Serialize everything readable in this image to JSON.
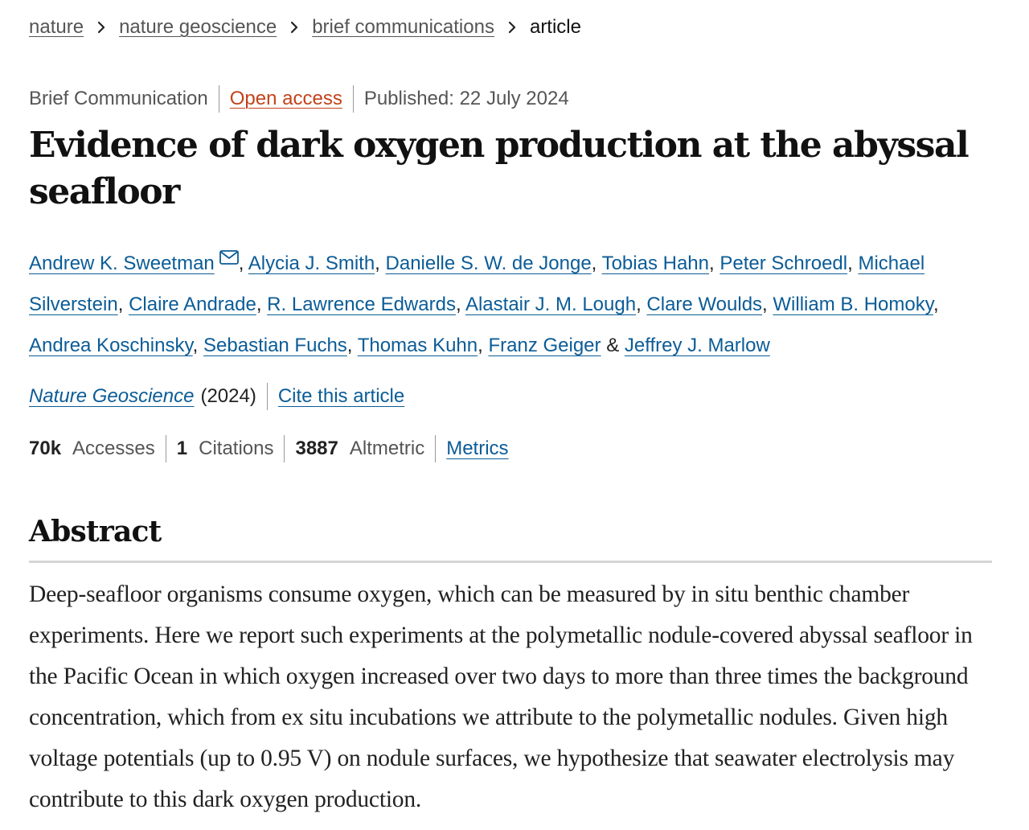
{
  "breadcrumb": {
    "items": [
      "nature",
      "nature geoscience",
      "brief communications"
    ],
    "current": "article"
  },
  "meta": {
    "type": "Brief Communication",
    "access": "Open access",
    "published": "Published: 22 July 2024"
  },
  "title": "Evidence of dark oxygen production at the abyssal seafloor",
  "authors": [
    "Andrew K. Sweetman",
    "Alycia J. Smith",
    "Danielle S. W. de Jonge",
    "Tobias Hahn",
    "Peter Schroedl",
    "Michael Silverstein",
    "Claire Andrade",
    "R. Lawrence Edwards",
    "Alastair J. M. Lough",
    "Clare Woulds",
    "William B. Homoky",
    "Andrea Koschinsky",
    "Sebastian Fuchs",
    "Thomas Kuhn",
    "Franz Geiger",
    "Jeffrey J. Marlow"
  ],
  "author_separator": ", ",
  "author_last_separator": " & ",
  "corresponding_icon": "mail-icon",
  "journal": {
    "name": "Nature Geoscience",
    "year": "(2024)",
    "cite_label": "Cite this article"
  },
  "metrics": {
    "accesses_value": "70k",
    "accesses_label": "Accesses",
    "citations_value": "1",
    "citations_label": "Citations",
    "altmetric_value": "3887",
    "altmetric_label": "Altmetric",
    "metrics_link": "Metrics"
  },
  "abstract": {
    "heading": "Abstract",
    "text": "Deep-seafloor organisms consume oxygen, which can be measured by in situ benthic chamber experiments. Here we report such experiments at the polymetallic nodule-covered abyssal seafloor in the Pacific Ocean in which oxygen increased over two days to more than three times the background concentration, which from ex situ incubations we attribute to the polymetallic nodules. Given high voltage potentials (up to 0.95 V) on nodule surfaces, we hypothesize that seawater electrolysis may contribute to this dark oxygen production."
  },
  "colors": {
    "link": "#0b5c97",
    "open_access": "#c4421a",
    "text": "#222222",
    "muted": "#555555"
  }
}
